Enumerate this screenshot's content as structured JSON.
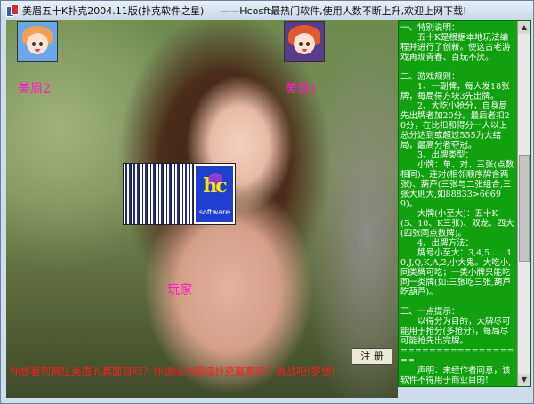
{
  "window": {
    "title_left": "美眉五十K扑克2004.11版(扑克软件之星)",
    "title_right": "——Hcosft最热门软件,使用人数不断上升,欢迎上网下载!"
  },
  "players": {
    "left_name": "美眉2",
    "right_name": "美眉1",
    "player_name": "玩家"
  },
  "logo": {
    "text": "hc",
    "caption": "software"
  },
  "register_button": "注 册",
  "bottom_message": "你想看到两位美眉的真面目吗？你想成为超级扑克赢家吗？挑战吧!梦想!",
  "rules_text": "一、特别说明：\n　　五十K是根据本地玩法编程并进行了创新。使这古老游戏再现青春、百玩不厌。\n\n二、游戏规则：\n　　1、一副牌，每人发18张牌，每局得方块3先出牌。\n　　2、大吃小抢分，自身局先出牌者加20分。最后者扣20分，在比扣和得分一人以上总分达到或超过555为大结局，最高分者夺冠。\n　　3、出牌类型：\n　　小牌：单、对、三张(点数相同)、连对(相邻顺序牌含两张)、葫芦(三张与二张组合,三张大则大,如88833>66699)。\n　　大牌(小至大)：五十K(5、10、K三张)、双龙、四大(四张同点数牌)。\n　　4、出牌方法：\n　　牌号小至大：3,4,5……10,J,Q,K,A,2,小大鬼。大吃小,同类牌可吃；一类小牌只能吃同一类牌(如:三张吃三张,葫芦吃葫芦)。\n\n三、一点提示：\n　　以得分为目的，大牌尽可能用于抢分(多抢分)，每局尽可能抢先出完牌。\n==================\n　　声明：未经作者同意，该软件不得用于商业目的!\n==================\n作者:吴运红(计算机业)"
}
